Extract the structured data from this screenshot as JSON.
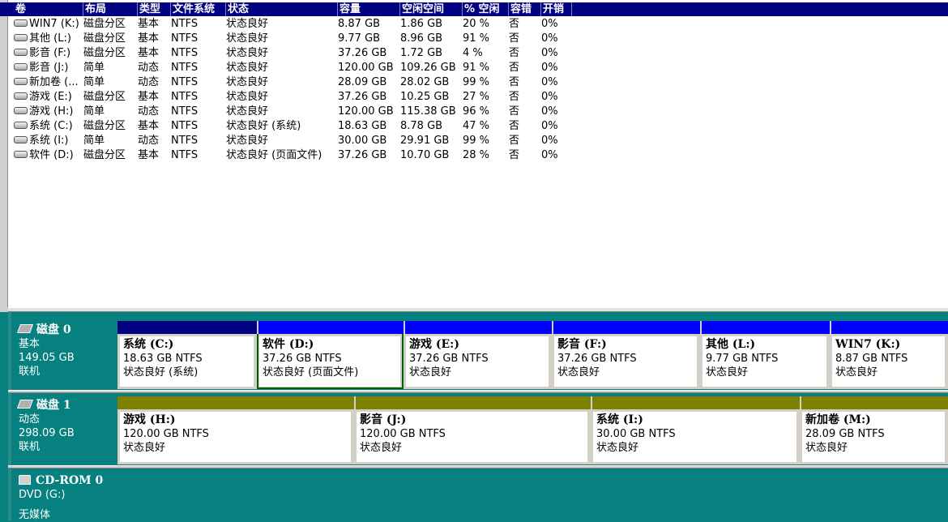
{
  "columns": [
    "卷",
    "布局",
    "类型",
    "文件系统",
    "状态",
    "容量",
    "空闲空间",
    "% 空闲",
    "容错",
    "开销"
  ],
  "volumes": [
    {
      "name": "WIN7 (K:)",
      "layout": "磁盘分区",
      "type": "基本",
      "fs": "NTFS",
      "status": "状态良好",
      "capacity": "8.87 GB",
      "free": "1.86 GB",
      "pct": "20 %",
      "ft": "否",
      "overhead": "0%"
    },
    {
      "name": "其他 (L:)",
      "layout": "磁盘分区",
      "type": "基本",
      "fs": "NTFS",
      "status": "状态良好",
      "capacity": "9.77 GB",
      "free": "8.96 GB",
      "pct": "91 %",
      "ft": "否",
      "overhead": "0%"
    },
    {
      "name": "影音 (F:)",
      "layout": "磁盘分区",
      "type": "基本",
      "fs": "NTFS",
      "status": "状态良好",
      "capacity": "37.26 GB",
      "free": "1.72 GB",
      "pct": "4 %",
      "ft": "否",
      "overhead": "0%"
    },
    {
      "name": "影音 (J:)",
      "layout": "简单",
      "type": "动态",
      "fs": "NTFS",
      "status": "状态良好",
      "capacity": "120.00 GB",
      "free": "109.26 GB",
      "pct": "91 %",
      "ft": "否",
      "overhead": "0%"
    },
    {
      "name": "新加卷 (...",
      "layout": "简单",
      "type": "动态",
      "fs": "NTFS",
      "status": "状态良好",
      "capacity": "28.09 GB",
      "free": "28.02 GB",
      "pct": "99 %",
      "ft": "否",
      "overhead": "0%"
    },
    {
      "name": "游戏 (E:)",
      "layout": "磁盘分区",
      "type": "基本",
      "fs": "NTFS",
      "status": "状态良好",
      "capacity": "37.26 GB",
      "free": "10.25 GB",
      "pct": "27 %",
      "ft": "否",
      "overhead": "0%"
    },
    {
      "name": "游戏 (H:)",
      "layout": "简单",
      "type": "动态",
      "fs": "NTFS",
      "status": "状态良好",
      "capacity": "120.00 GB",
      "free": "115.38 GB",
      "pct": "96 %",
      "ft": "否",
      "overhead": "0%"
    },
    {
      "name": "系统 (C:)",
      "layout": "磁盘分区",
      "type": "基本",
      "fs": "NTFS",
      "status": "状态良好 (系统)",
      "capacity": "18.63 GB",
      "free": "8.78 GB",
      "pct": "47 %",
      "ft": "否",
      "overhead": "0%"
    },
    {
      "name": "系统 (I:)",
      "layout": "简单",
      "type": "动态",
      "fs": "NTFS",
      "status": "状态良好",
      "capacity": "30.00 GB",
      "free": "29.91 GB",
      "pct": "99 %",
      "ft": "否",
      "overhead": "0%"
    },
    {
      "name": "软件 (D:)",
      "layout": "磁盘分区",
      "type": "基本",
      "fs": "NTFS",
      "status": "状态良好 (页面文件)",
      "capacity": "37.26 GB",
      "free": "10.70 GB",
      "pct": "28 %",
      "ft": "否",
      "overhead": "0%"
    }
  ],
  "disks": [
    {
      "name": "磁盘 0",
      "type": "基本",
      "size": "149.05 GB",
      "state": "联机",
      "partitions": [
        {
          "name": "系统  (C:)",
          "size": "18.63 GB NTFS",
          "status": "状态良好 (系统)",
          "kind": "system"
        },
        {
          "name": "软件  (D:)",
          "size": "37.26 GB NTFS",
          "status": "状态良好 (页面文件)",
          "kind": "primary",
          "selected": true
        },
        {
          "name": "游戏  (E:)",
          "size": "37.26 GB NTFS",
          "status": "状态良好",
          "kind": "primary"
        },
        {
          "name": "影音  (F:)",
          "size": "37.26 GB NTFS",
          "status": "状态良好",
          "kind": "primary"
        },
        {
          "name": "其他  (L:)",
          "size": "9.77 GB NTFS",
          "status": "状态良好",
          "kind": "primary"
        },
        {
          "name": "WIN7  (K:)",
          "size": "8.87 GB NTFS",
          "status": "状态良好",
          "kind": "primary"
        }
      ]
    },
    {
      "name": "磁盘 1",
      "type": "动态",
      "size": "298.09 GB",
      "state": "联机",
      "partitions": [
        {
          "name": "游戏  (H:)",
          "size": "120.00 GB NTFS",
          "status": "状态良好",
          "kind": "dyn"
        },
        {
          "name": "影音  (J:)",
          "size": "120.00 GB NTFS",
          "status": "状态良好",
          "kind": "dyn"
        },
        {
          "name": "系统  (I:)",
          "size": "30.00 GB NTFS",
          "status": "状态良好",
          "kind": "dyn"
        },
        {
          "name": "新加卷  (M:)",
          "size": "28.09 GB NTFS",
          "status": "状态良好",
          "kind": "dyn"
        }
      ]
    }
  ],
  "cdrom": {
    "name": "CD-ROM 0",
    "drive": "DVD (G:)",
    "state": "无媒体"
  },
  "icons": {
    "volume": "drive-icon",
    "disk": "hard-disk-icon",
    "cdrom": "cdrom-icon"
  }
}
